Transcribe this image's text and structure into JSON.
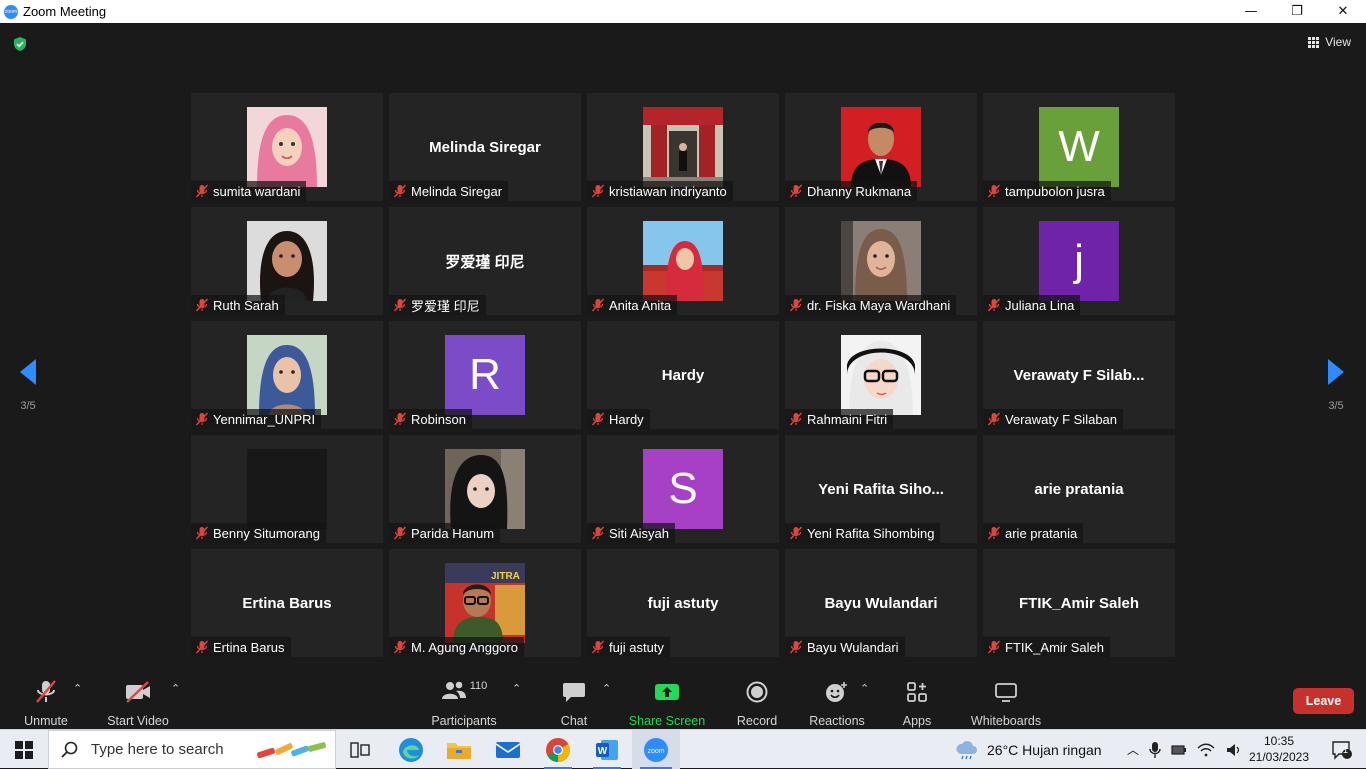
{
  "window": {
    "title": "Zoom Meeting",
    "minimize": "—",
    "restore": "❐",
    "close": "✕"
  },
  "view_label": "View",
  "gallery": {
    "tiles": [
      {
        "name": "sumita wardani",
        "display": "photo",
        "photo": "woman-pink-hijab"
      },
      {
        "name": "Melinda Siregar",
        "display": "name",
        "big": "Melinda Siregar"
      },
      {
        "name": "kristiawan indriyanto",
        "display": "photo",
        "photo": "temple-red-gate"
      },
      {
        "name": "Dhanny Rukmana",
        "display": "photo",
        "photo": "man-suit-red-bg"
      },
      {
        "name": "tampubolon jusra",
        "display": "letter",
        "letter": "W",
        "color": "#6aa039"
      },
      {
        "name": "Ruth Sarah",
        "display": "photo",
        "photo": "woman-dark-hair"
      },
      {
        "name": "罗爱瑾 印尼",
        "display": "name",
        "big": "罗爱瑾 印尼"
      },
      {
        "name": "Anita Anita",
        "display": "photo",
        "photo": "woman-red-hijab"
      },
      {
        "name": "dr. Fiska Maya Wardhani",
        "display": "photo",
        "photo": "woman-brown-hijab"
      },
      {
        "name": "Juliana Lina",
        "display": "letter",
        "letter": "j",
        "color": "#6f23a8"
      },
      {
        "name": "Yennimar_UNPRI",
        "display": "photo",
        "photo": "woman-blue-hijab"
      },
      {
        "name": "Robinson",
        "display": "letter",
        "letter": "R",
        "color": "#7b4bc8"
      },
      {
        "name": "Hardy",
        "display": "name",
        "big": "Hardy"
      },
      {
        "name": "Rahmaini Fitri",
        "display": "photo",
        "photo": "woman-glasses-hijab"
      },
      {
        "name": "Verawaty F Silaban",
        "display": "name",
        "big": "Verawaty  F  Silab..."
      },
      {
        "name": "Benny Situmorang",
        "display": "photo",
        "photo": "dark-image"
      },
      {
        "name": "Parida Hanum",
        "display": "photo",
        "photo": "woman-selfie"
      },
      {
        "name": "Siti Aisyah",
        "display": "letter",
        "letter": "S",
        "color": "#a640c4"
      },
      {
        "name": "Yeni Rafita Sihombing",
        "display": "name",
        "big": "Yeni  Rafita  Siho..."
      },
      {
        "name": "arie pratania",
        "display": "name",
        "big": "arie pratania"
      },
      {
        "name": "Ertina Barus",
        "display": "name",
        "big": "Ertina Barus"
      },
      {
        "name": "M. Agung Anggoro",
        "display": "photo",
        "photo": "man-glasses-street"
      },
      {
        "name": "fuji astuty",
        "display": "name",
        "big": "fuji astuty"
      },
      {
        "name": "Bayu Wulandari",
        "display": "name",
        "big": "Bayu Wulandari"
      },
      {
        "name": "FTIK_Amir Saleh",
        "display": "name",
        "big": "FTIK_Amir Saleh"
      }
    ]
  },
  "page_nav": {
    "left_page": "3/5",
    "right_page": "3/5"
  },
  "toolbar": {
    "unmute": "Unmute",
    "start_video": "Start Video",
    "participants": "Participants",
    "participant_count": "110",
    "chat": "Chat",
    "share_screen": "Share Screen",
    "record": "Record",
    "reactions": "Reactions",
    "apps": "Apps",
    "whiteboards": "Whiteboards",
    "leave": "Leave",
    "accent": "#23d959",
    "leave_color": "#c7302b"
  },
  "taskbar": {
    "search_placeholder": "Type here to search",
    "weather": "26°C  Hujan ringan",
    "time": "10:35",
    "date": "21/03/2023",
    "notif_count": "1",
    "apps": [
      "task-view",
      "edge",
      "file-explorer",
      "mail",
      "chrome",
      "word",
      "zoom"
    ]
  }
}
